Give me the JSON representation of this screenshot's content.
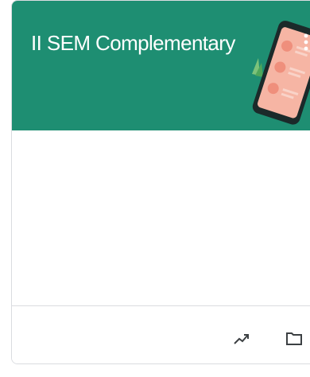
{
  "card": {
    "title": "II SEM Complementary",
    "banner_color": "#1e8e72"
  },
  "icons": {
    "more": "more-vert-icon",
    "gradebook": "trending-up-icon",
    "folder": "folder-icon"
  }
}
